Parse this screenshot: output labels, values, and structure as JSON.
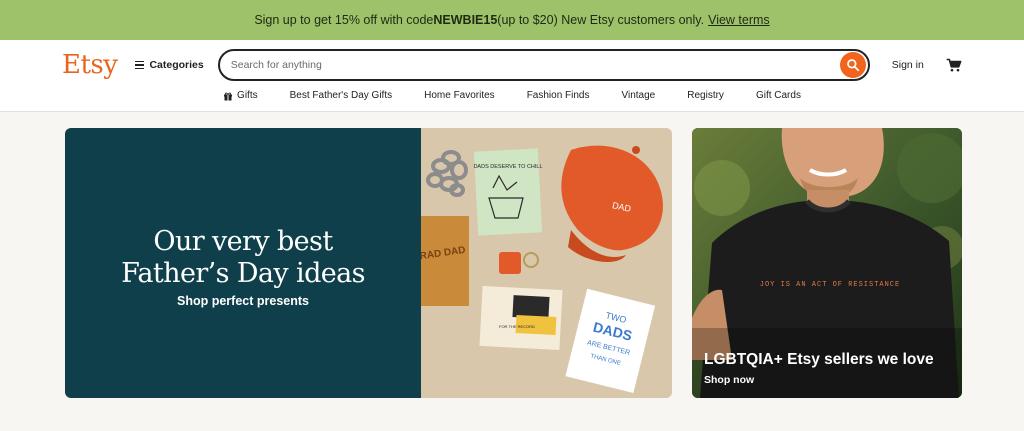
{
  "promo": {
    "text_before": "Sign up to get 15% off with code ",
    "code": "NEWBIE15",
    "text_after": " (up to $20) New Etsy customers only.",
    "link": "View terms"
  },
  "header": {
    "logo": "Etsy",
    "categories_label": "Categories",
    "search_placeholder": "Search for anything",
    "sign_in": "Sign in"
  },
  "nav": {
    "items": [
      "Gifts",
      "Best Father's Day Gifts",
      "Home Favorites",
      "Fashion Finds",
      "Vintage",
      "Registry",
      "Gift Cards"
    ]
  },
  "hero": {
    "title_line1": "Our very best",
    "title_line2": "Father’s Day ideas",
    "subtitle": "Shop perfect presents",
    "image": {
      "card1_text": "DADS DESERVE TO CHILL",
      "cap_text": "DAD",
      "card2_text": "RAD DAD",
      "card3_text": "FOR THE RECORD",
      "card4_line1": "TWO",
      "card4_line2": "DADS",
      "card4_line3": "ARE BETTER",
      "card4_line4": "THAN ONE"
    }
  },
  "promo_card": {
    "title": "LGBTQIA+ Etsy sellers we love",
    "cta": "Shop now",
    "shirt_text": "JOY IS AN ACT OF RESISTANCE"
  },
  "colors": {
    "promo_bg": "#9ec26a",
    "brand_orange": "#f1641e",
    "hero_teal": "#0e3f4b"
  }
}
